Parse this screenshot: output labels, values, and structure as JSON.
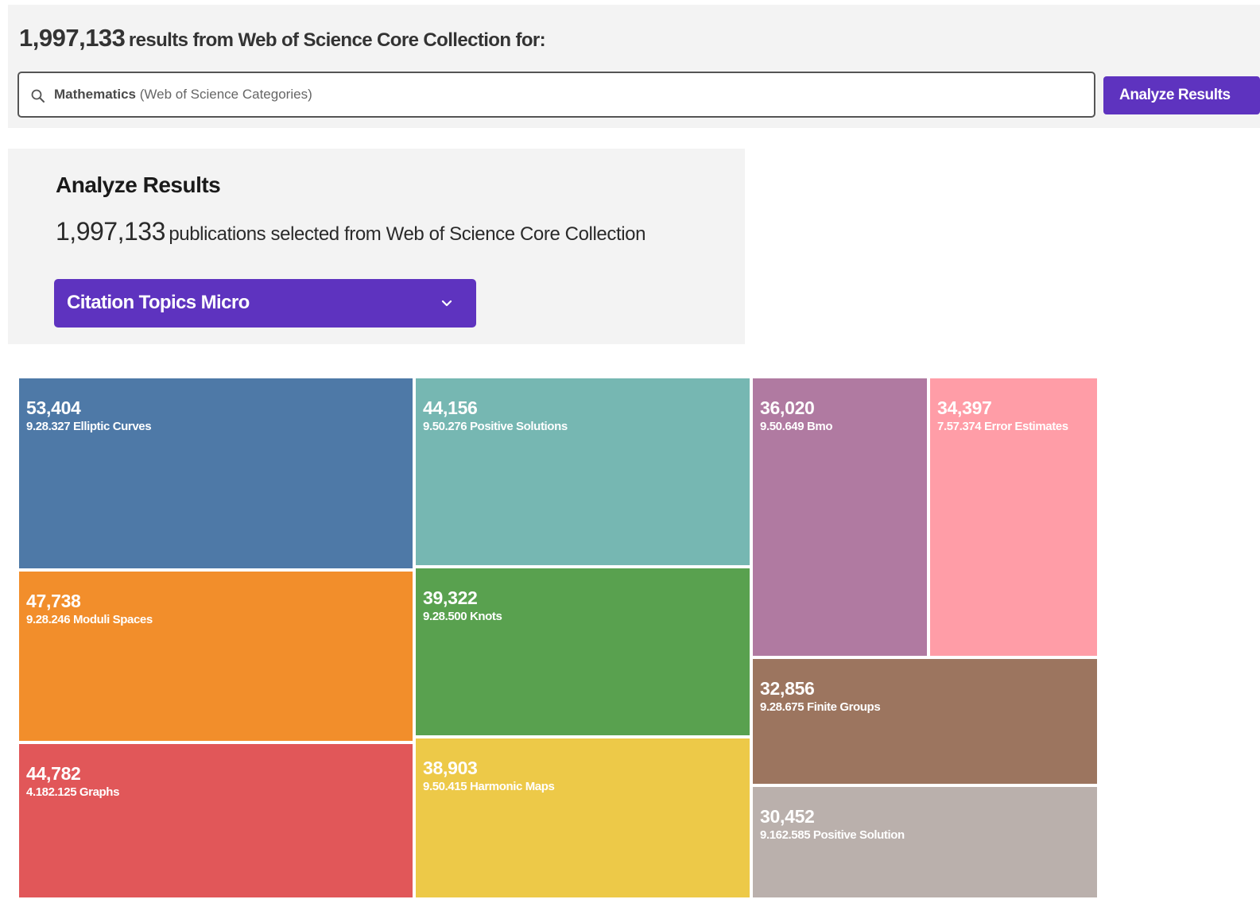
{
  "results": {
    "count": "1,997,133",
    "text": "results from Web of Science Core Collection for:"
  },
  "search": {
    "term": "Mathematics",
    "qualifier": "(Web of Science Categories)",
    "icon": "search-icon"
  },
  "analyze_button": {
    "label": "Analyze Results",
    "color": "#5e33bf"
  },
  "analyze_panel": {
    "title": "Analyze Results",
    "count": "1,997,133",
    "text": "publications selected from Web of Science Core Collection",
    "field_select": {
      "value": "Citation Topics Micro",
      "icon": "chevron-down-icon"
    }
  },
  "chart_data": {
    "type": "treemap",
    "title": "",
    "items": [
      {
        "value": 53404,
        "count_label": "53,404",
        "label": "9.28.327 Elliptic Curves",
        "color": "#4e79a7"
      },
      {
        "value": 47738,
        "count_label": "47,738",
        "label": "9.28.246 Moduli Spaces",
        "color": "#f28e2b"
      },
      {
        "value": 44782,
        "count_label": "44,782",
        "label": "4.182.125 Graphs",
        "color": "#e15759"
      },
      {
        "value": 44156,
        "count_label": "44,156",
        "label": "9.50.276 Positive Solutions",
        "color": "#76b7b2"
      },
      {
        "value": 39322,
        "count_label": "39,322",
        "label": "9.28.500 Knots",
        "color": "#59a14f"
      },
      {
        "value": 38903,
        "count_label": "38,903",
        "label": "9.50.415 Harmonic Maps",
        "color": "#edc948"
      },
      {
        "value": 36020,
        "count_label": "36,020",
        "label": "9.50.649 Bmo",
        "color": "#b07aa1"
      },
      {
        "value": 34397,
        "count_label": "34,397",
        "label": "7.57.374 Error Estimates",
        "color": "#ff9da7"
      },
      {
        "value": 32856,
        "count_label": "32,856",
        "label": "9.28.675 Finite Groups",
        "color": "#9c755f"
      },
      {
        "value": 30452,
        "count_label": "30,452",
        "label": "9.162.585 Positive Solution",
        "color": "#bab0ac"
      }
    ]
  }
}
